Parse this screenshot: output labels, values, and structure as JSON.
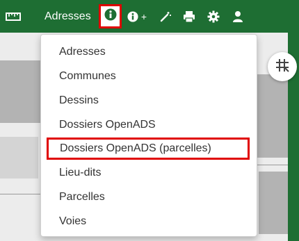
{
  "toolbar": {
    "search_value": "Adresses",
    "info_plus_label": "+",
    "colors": {
      "background": "#1e6e33",
      "highlight": "#e00000"
    },
    "icons": [
      "ruler-icon",
      "info-icon",
      "info-plus-icon",
      "magic-wand-icon",
      "print-icon",
      "settings-icon",
      "user-icon"
    ]
  },
  "dropdown": {
    "items": [
      {
        "label": "Adresses"
      },
      {
        "label": "Communes"
      },
      {
        "label": "Dessins"
      },
      {
        "label": "Dossiers OpenADS"
      },
      {
        "label": "Dossiers OpenADS (parcelles)",
        "highlighted": true
      },
      {
        "label": "Lieu-dits"
      },
      {
        "label": "Parcelles"
      },
      {
        "label": "Voies"
      }
    ]
  },
  "map": {
    "grid_button_icon": "grid-icon"
  }
}
